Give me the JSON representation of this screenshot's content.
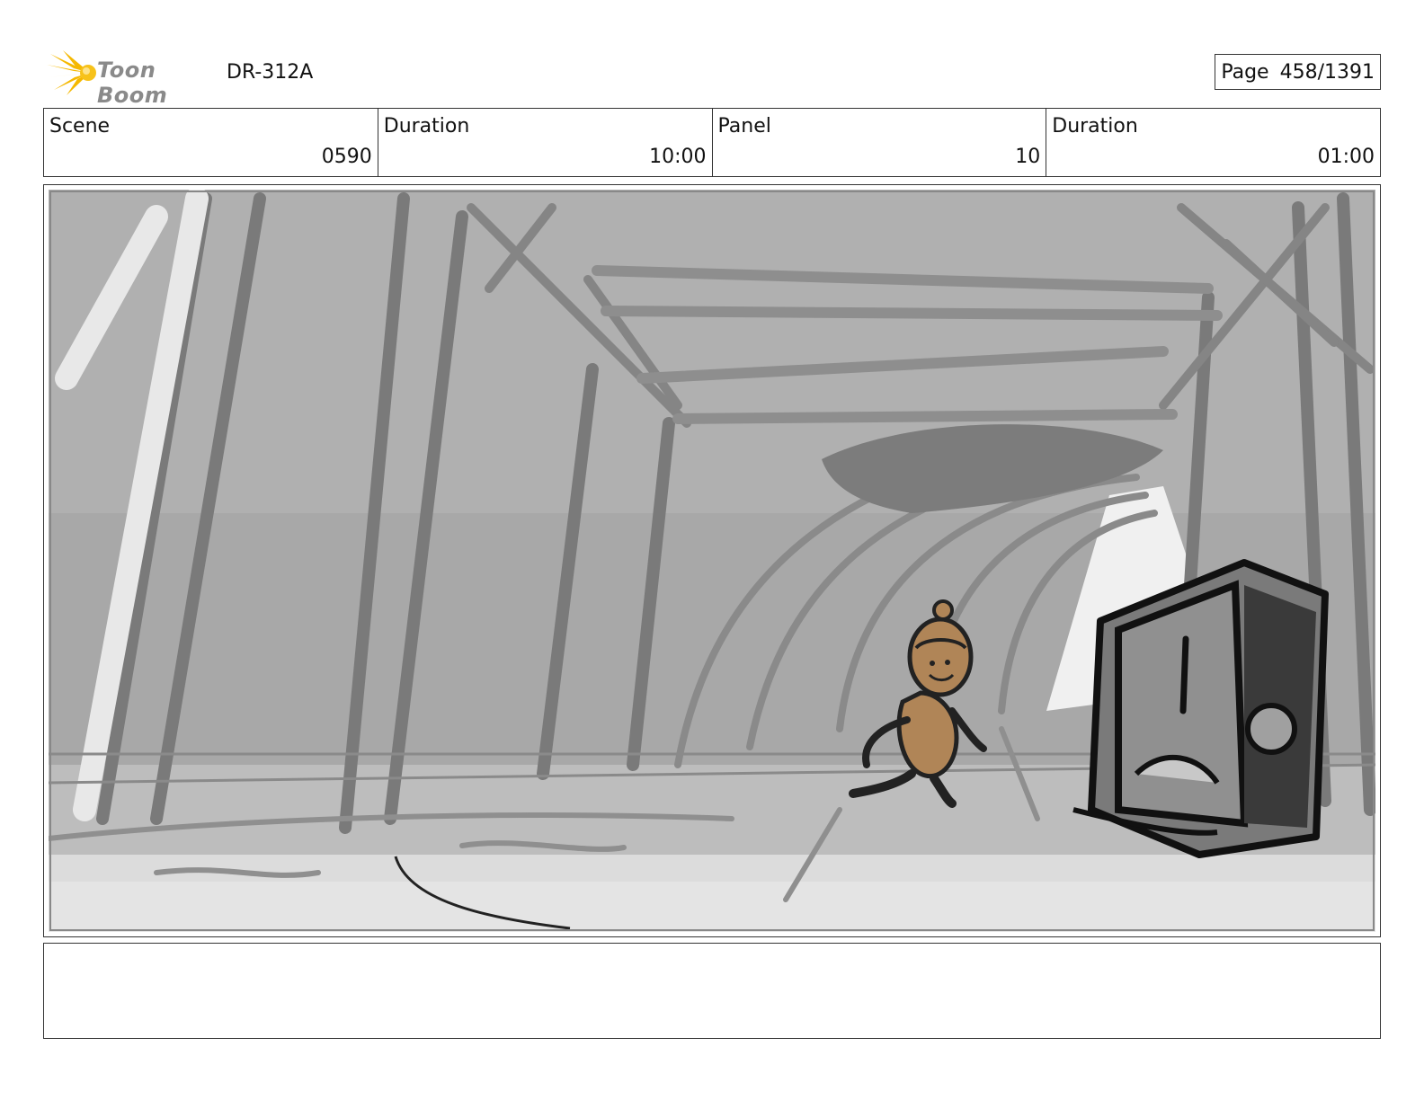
{
  "header": {
    "logo_text": "Toon Boom",
    "doc_id": "DR-312A",
    "page_label": "Page",
    "page_value": "458/1391"
  },
  "info": {
    "scene_label": "Scene",
    "scene_value": "0590",
    "scene_duration_label": "Duration",
    "scene_duration_value": "10:00",
    "panel_label": "Panel",
    "panel_value": "10",
    "panel_duration_label": "Duration",
    "panel_duration_value": "01:00"
  },
  "colors": {
    "logo_accent": "#f5b800",
    "sketch_background": "#a9a9a9",
    "character_fill": "#b08557"
  }
}
